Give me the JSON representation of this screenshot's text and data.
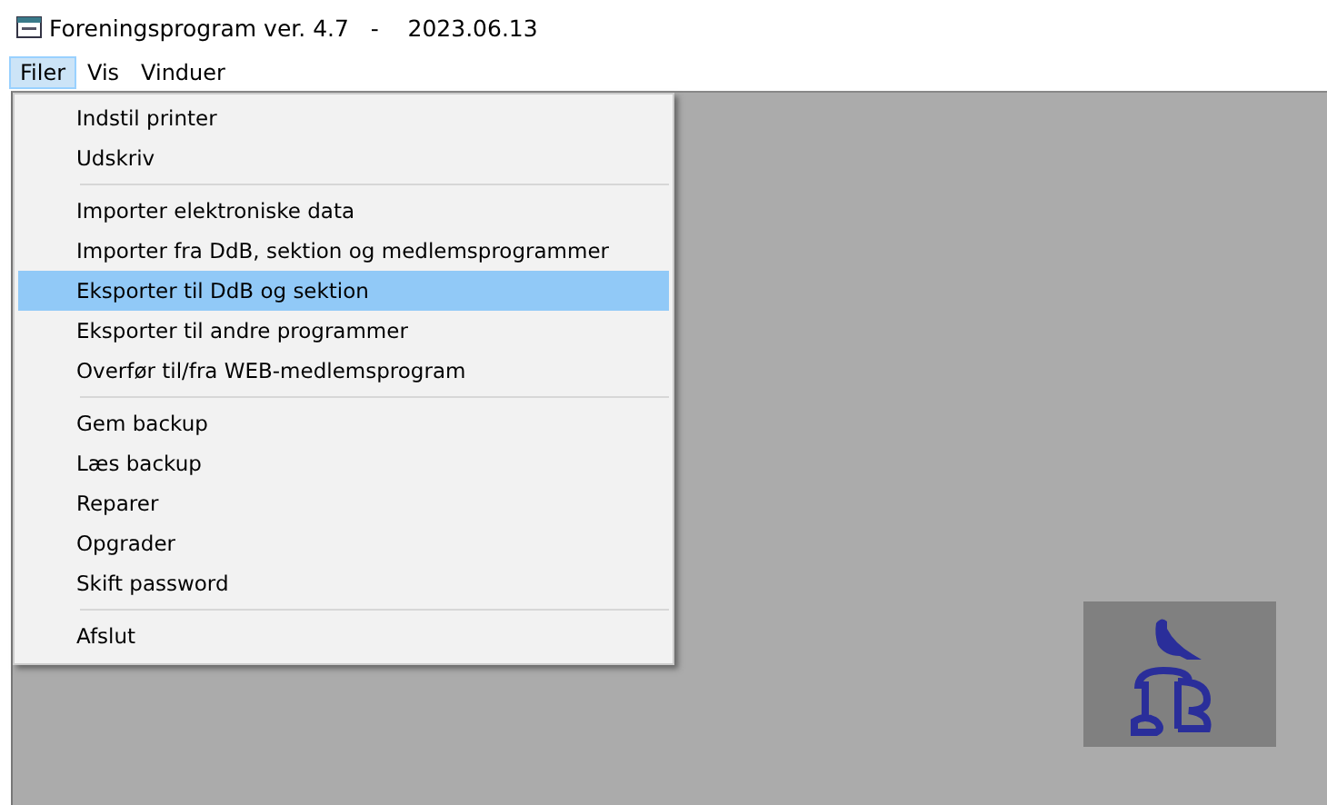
{
  "window": {
    "title": "Foreningsprogram ver. 4.7   -    2023.06.13"
  },
  "menu_bar": [
    {
      "label": "Filer",
      "selected": true
    },
    {
      "label": "Vis",
      "selected": false
    },
    {
      "label": "Vinduer",
      "selected": false
    }
  ],
  "menu": {
    "groups": [
      [
        {
          "label": "Indstil printer",
          "selected": false
        },
        {
          "label": "Udskriv",
          "selected": false
        }
      ],
      [
        {
          "label": "Importer elektroniske data",
          "selected": false
        },
        {
          "label": "Importer fra DdB, sektion og medlemsprogrammer",
          "selected": false
        },
        {
          "label": "Eksporter til DdB og sektion",
          "selected": true
        },
        {
          "label": "Eksporter til andre programmer",
          "selected": false
        },
        {
          "label": "Overfør til/fra WEB-medlemsprogram",
          "selected": false
        }
      ],
      [
        {
          "label": "Gem backup",
          "selected": false
        },
        {
          "label": "Læs backup",
          "selected": false
        },
        {
          "label": "Reparer",
          "selected": false
        },
        {
          "label": "Opgrader",
          "selected": false
        },
        {
          "label": "Skift password",
          "selected": false
        }
      ],
      [
        {
          "label": "Afslut",
          "selected": false
        }
      ]
    ]
  }
}
